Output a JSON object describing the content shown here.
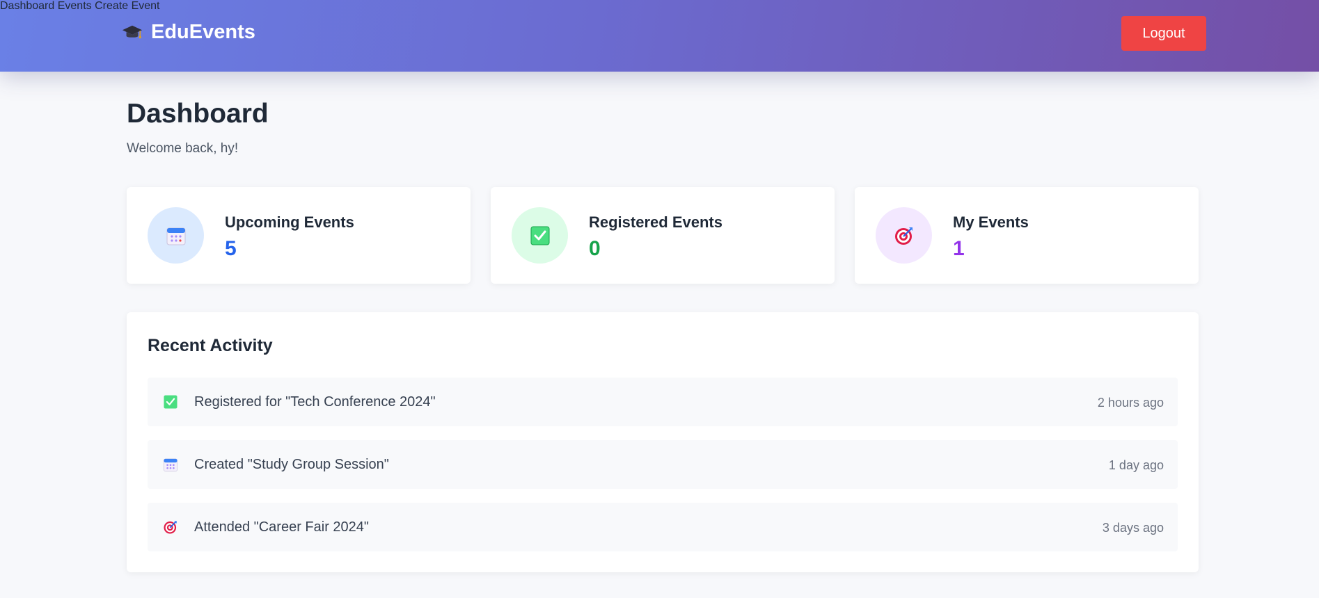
{
  "brand": {
    "name": "EduEvents",
    "icon": "graduation-cap-icon"
  },
  "nav": {
    "dashboard": "Dashboard",
    "events": "Events",
    "create_event": "Create Event",
    "logout": "Logout"
  },
  "page": {
    "title": "Dashboard",
    "welcome": "Welcome back, hy!"
  },
  "stats": [
    {
      "label": "Upcoming Events",
      "value": "5",
      "icon": "calendar-icon",
      "color": "#2563eb",
      "bg": "#dbeafe"
    },
    {
      "label": "Registered Events",
      "value": "0",
      "icon": "check-box-icon",
      "color": "#16a34a",
      "bg": "#dcfce7"
    },
    {
      "label": "My Events",
      "value": "1",
      "icon": "target-icon",
      "color": "#9333ea",
      "bg": "#f3e8ff"
    }
  ],
  "activity": {
    "title": "Recent Activity",
    "items": [
      {
        "text": "Registered for \"Tech Conference 2024\"",
        "time": "2 hours ago",
        "icon": "check-box-icon"
      },
      {
        "text": "Created \"Study Group Session\"",
        "time": "1 day ago",
        "icon": "calendar-icon"
      },
      {
        "text": "Attended \"Career Fair 2024\"",
        "time": "3 days ago",
        "icon": "target-icon"
      }
    ]
  },
  "colors": {
    "logout": "#ef4444",
    "header_start": "#6a80e6",
    "header_end": "#744fa6"
  }
}
